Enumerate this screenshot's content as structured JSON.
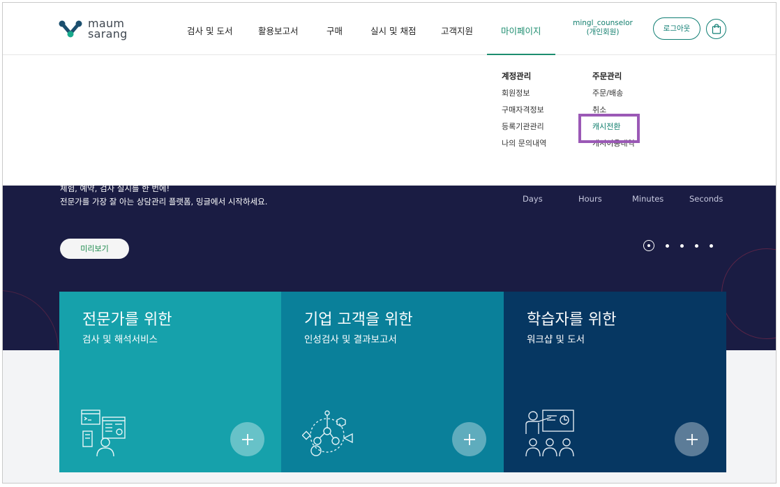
{
  "brand": {
    "logo_line1": "maum",
    "logo_line2": "sarang",
    "accent": "#1d8d6f"
  },
  "nav": {
    "items": [
      "검사 및 도서",
      "활용보고서",
      "구매",
      "실시 및 채점",
      "고객지원",
      "마이페이지"
    ],
    "active": "마이페이지"
  },
  "user": {
    "name": "mingl_counselor",
    "type": "(개인회원)"
  },
  "header_buttons": {
    "logout": "로그아웃",
    "cart_icon": "shopping-bag-icon"
  },
  "dropdown": {
    "account": {
      "heading": "계정관리",
      "items": [
        "회원정보",
        "구매자격정보",
        "등록기관관리",
        "나의 문의내역"
      ]
    },
    "orders": {
      "heading": "주문관리",
      "items": [
        "주문/배송",
        "취소",
        "캐시전환",
        "캐시이용내역"
      ],
      "highlighted": "캐시전환"
    }
  },
  "hero": {
    "line1": "체험, 예약, 검사 실시를 한 번에!",
    "line2": "전문가를 가장 잘 아는 상담관리 플랫폼, 밍글에서 시작하세요.",
    "countdown_labels": [
      "Days",
      "Hours",
      "Minutes",
      "Seconds"
    ],
    "preview_button": "미리보기",
    "slide_count": 5,
    "active_slide": 1
  },
  "cards": [
    {
      "title": "전문가를 위한",
      "subtitle": "검사 및 해석서비스",
      "color": "#16a1ab"
    },
    {
      "title": "기업 고객을 위한",
      "subtitle": "인성검사 및 결과보고서",
      "color": "#0a809a"
    },
    {
      "title": "학습자를 위한",
      "subtitle": "워크샵 및 도서",
      "color": "#063762"
    }
  ]
}
